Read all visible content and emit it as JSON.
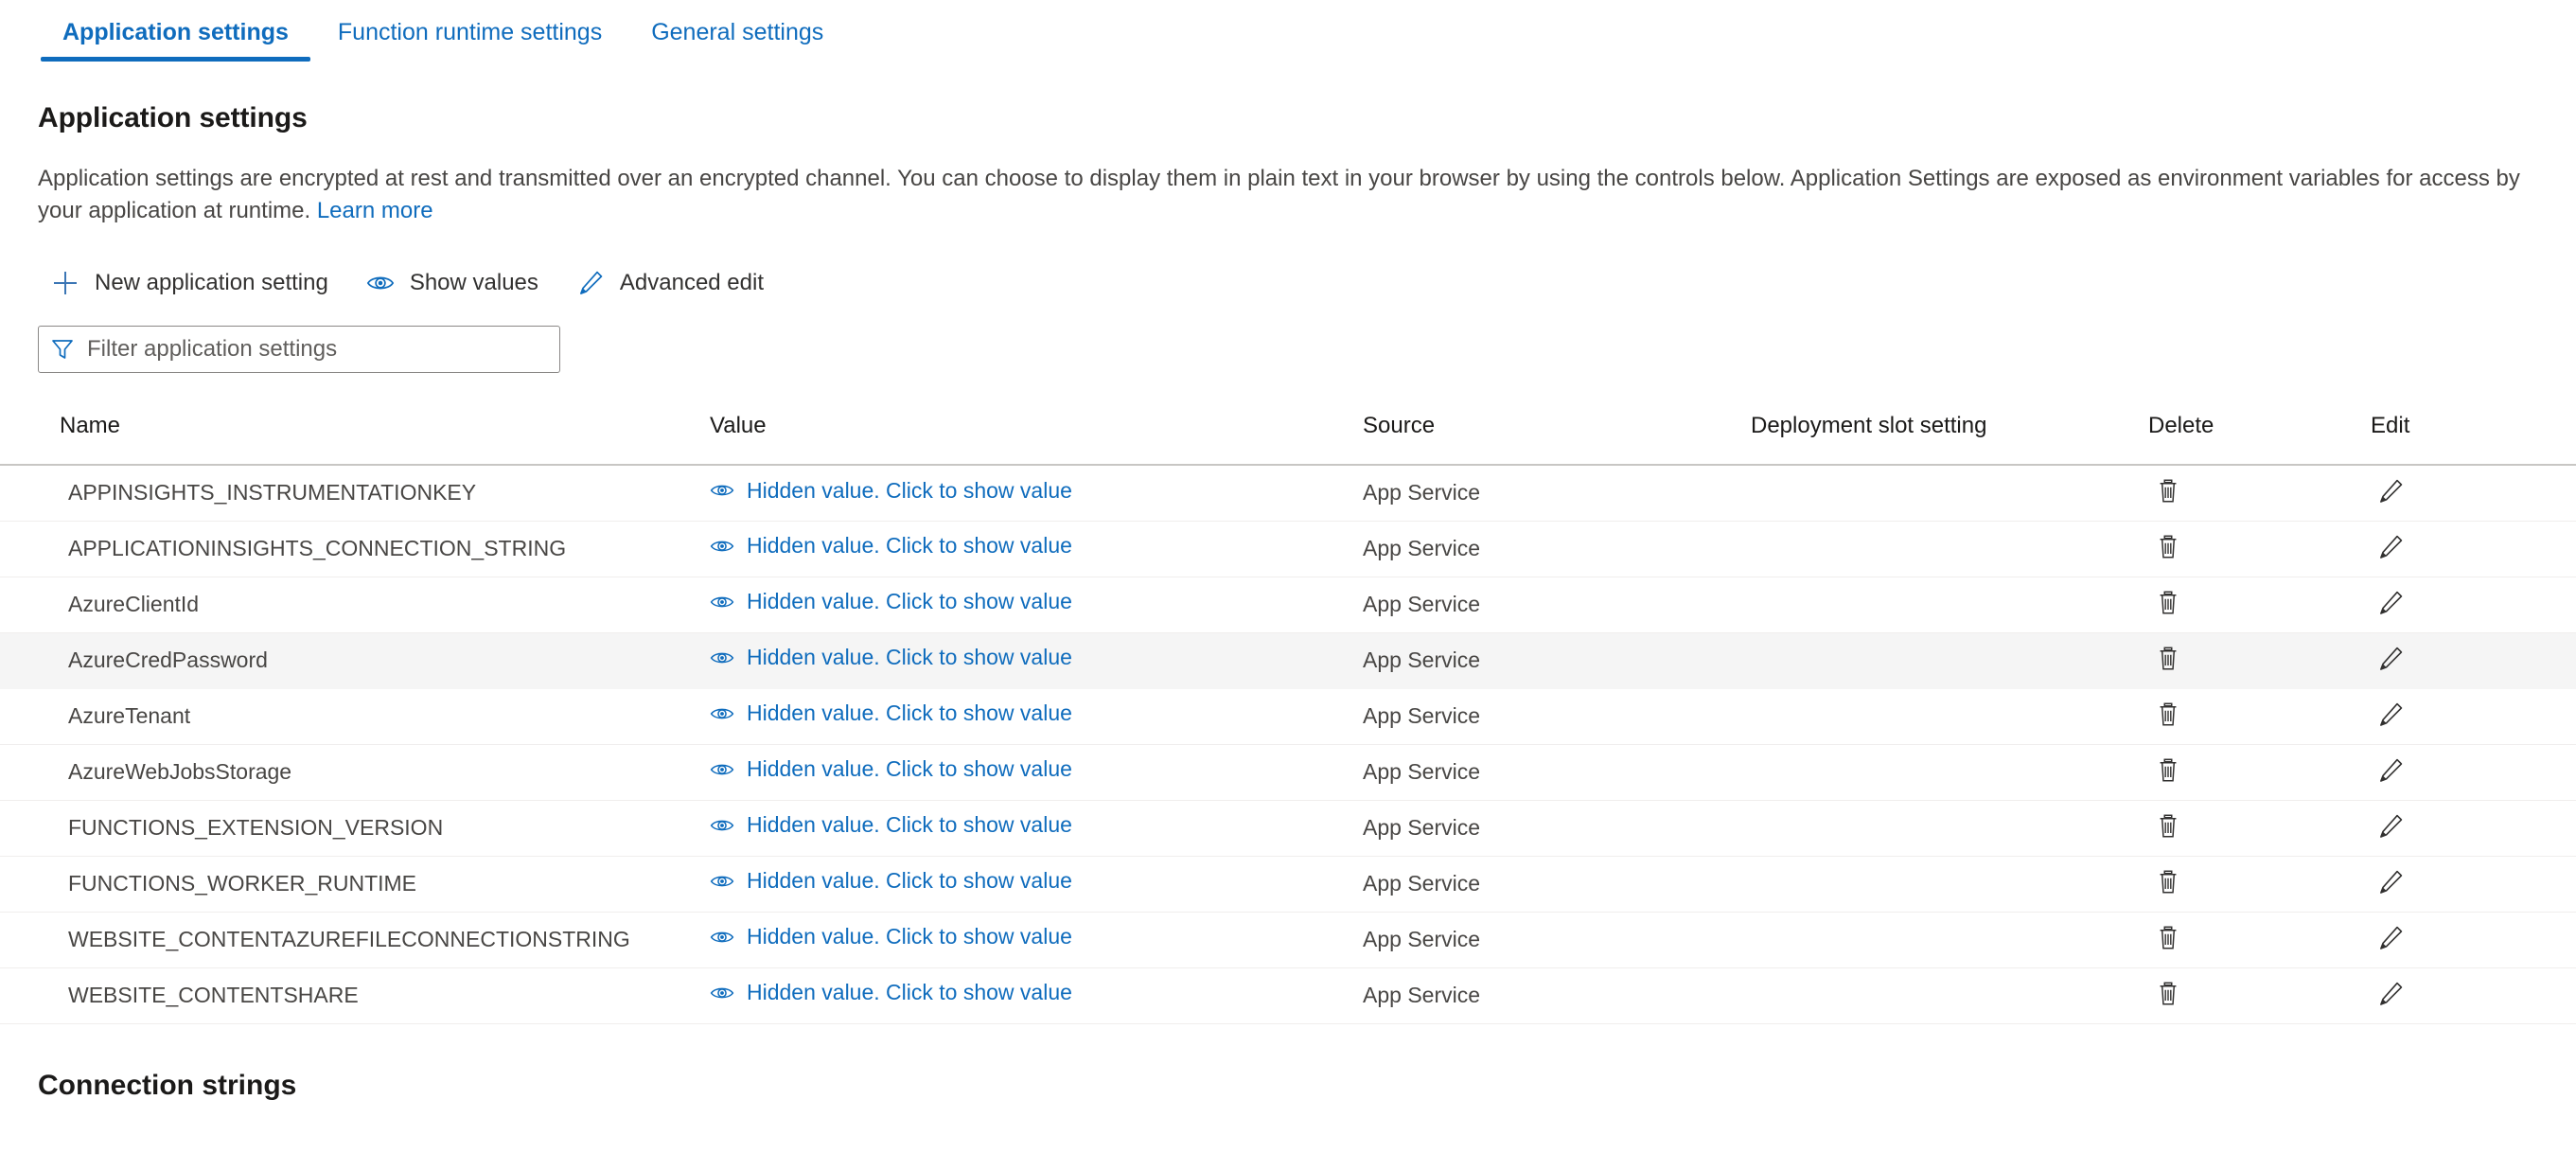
{
  "tabs": [
    {
      "label": "Application settings",
      "active": true
    },
    {
      "label": "Function runtime settings",
      "active": false
    },
    {
      "label": "General settings",
      "active": false
    }
  ],
  "page": {
    "title": "Application settings",
    "description_part1": "Application settings are encrypted at rest and transmitted over an encrypted channel. You can choose to display them in plain text in your browser by using the controls below. Application Settings are exposed as environment variables for access by your application at runtime. ",
    "learn_more": "Learn more",
    "connection_strings_title": "Connection strings"
  },
  "toolbar": {
    "new_setting": "New application setting",
    "new_setting_icon": "plus-icon",
    "show_values": "Show values",
    "show_values_icon": "eye-icon",
    "advanced_edit": "Advanced edit",
    "advanced_edit_icon": "pencil-icon"
  },
  "filter": {
    "placeholder": "Filter application settings",
    "value": "",
    "icon": "funnel-icon"
  },
  "table": {
    "headers": {
      "name": "Name",
      "value": "Value",
      "source": "Source",
      "slot": "Deployment slot setting",
      "delete": "Delete",
      "edit": "Edit"
    },
    "hidden_value_label": "Hidden value. Click to show value",
    "delete_icon": "trash-icon",
    "edit_icon": "pencil-icon",
    "value_icon": "eye-icon",
    "rows": [
      {
        "name": "APPINSIGHTS_INSTRUMENTATIONKEY",
        "value": "Hidden value. Click to show value",
        "source": "App Service",
        "slot": "",
        "highlighted": false
      },
      {
        "name": "APPLICATIONINSIGHTS_CONNECTION_STRING",
        "value": "Hidden value. Click to show value",
        "source": "App Service",
        "slot": "",
        "highlighted": false
      },
      {
        "name": "AzureClientId",
        "value": "Hidden value. Click to show value",
        "source": "App Service",
        "slot": "",
        "highlighted": false
      },
      {
        "name": "AzureCredPassword",
        "value": "Hidden value. Click to show value",
        "source": "App Service",
        "slot": "",
        "highlighted": true
      },
      {
        "name": "AzureTenant",
        "value": "Hidden value. Click to show value",
        "source": "App Service",
        "slot": "",
        "highlighted": false
      },
      {
        "name": "AzureWebJobsStorage",
        "value": "Hidden value. Click to show value",
        "source": "App Service",
        "slot": "",
        "highlighted": false
      },
      {
        "name": "FUNCTIONS_EXTENSION_VERSION",
        "value": "Hidden value. Click to show value",
        "source": "App Service",
        "slot": "",
        "highlighted": false
      },
      {
        "name": "FUNCTIONS_WORKER_RUNTIME",
        "value": "Hidden value. Click to show value",
        "source": "App Service",
        "slot": "",
        "highlighted": false
      },
      {
        "name": "WEBSITE_CONTENTAZUREFILECONNECTIONSTRING",
        "value": "Hidden value. Click to show value",
        "source": "App Service",
        "slot": "",
        "highlighted": false
      },
      {
        "name": "WEBSITE_CONTENTSHARE",
        "value": "Hidden value. Click to show value",
        "source": "App Service",
        "slot": "",
        "highlighted": false
      }
    ]
  },
  "colors": {
    "accent": "#0f6cbd",
    "link": "#0f6cbd",
    "text": "#323130",
    "muted": "#484644",
    "row_highlight": "#f5f5f5",
    "border": "#c8c6c4"
  }
}
